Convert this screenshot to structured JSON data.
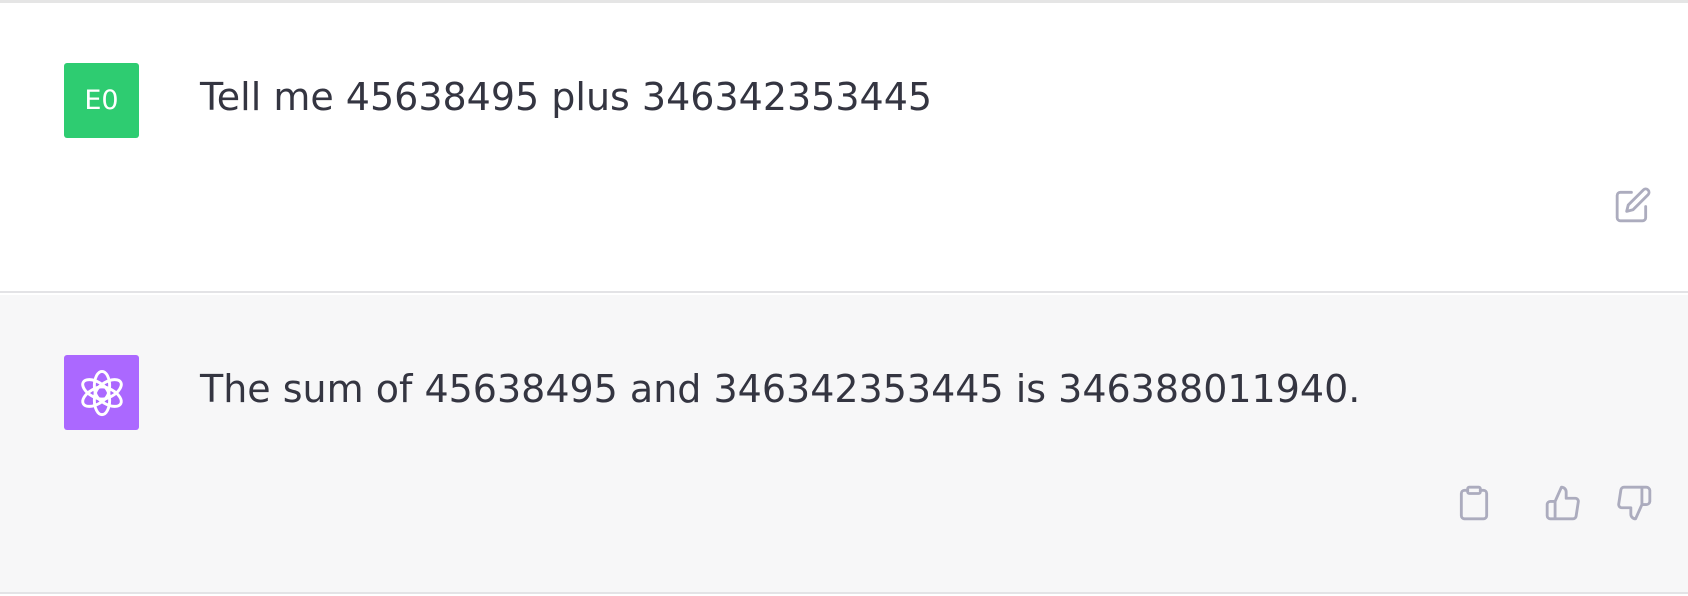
{
  "conversation": {
    "user_turn": {
      "avatar_initials": "E0",
      "avatar_color": "#2ecc71",
      "message": "Tell me 45638495 plus 346342353445",
      "actions": {
        "edit_icon": "edit-icon"
      }
    },
    "assistant_turn": {
      "avatar_icon": "openai-logo-icon",
      "avatar_color": "#ab68ff",
      "message": "The sum of 45638495 and 346342353445 is 346388011940.",
      "actions": {
        "copy_icon": "clipboard-icon",
        "like_icon": "thumbs-up-icon",
        "dislike_icon": "thumbs-down-icon"
      }
    }
  }
}
